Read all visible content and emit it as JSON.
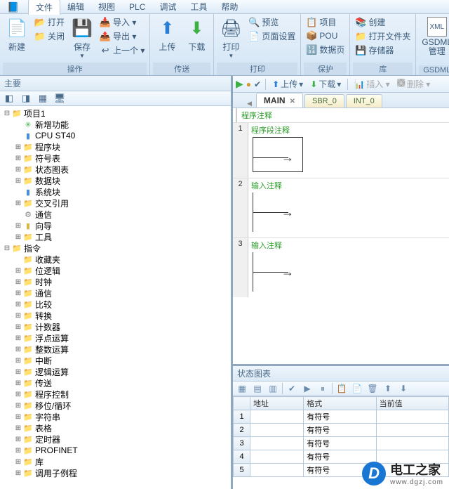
{
  "menu": {
    "items": [
      "文件",
      "编辑",
      "视图",
      "PLC",
      "调试",
      "工具",
      "帮助"
    ],
    "active": 0
  },
  "ribbon": {
    "groups": [
      {
        "title": "操作",
        "big": [
          {
            "icon": "📄",
            "label": "新建"
          }
        ],
        "small": [
          {
            "icon": "📂",
            "label": "打开"
          },
          {
            "icon": "✖",
            "label": "关闭"
          }
        ],
        "big2": [
          {
            "icon": "💾",
            "label": "保存",
            "drop": true
          }
        ],
        "small2": [
          {
            "icon": "📥",
            "label": "导入 ▾"
          },
          {
            "icon": "📤",
            "label": "导出 ▾"
          },
          {
            "icon": "↩",
            "label": "上一个 ▾"
          }
        ]
      },
      {
        "title": "传送",
        "big": [
          {
            "icon": "⬆",
            "label": "上传",
            "cls": "arrow-up"
          },
          {
            "icon": "⬇",
            "label": "下载",
            "cls": "arrow-down"
          }
        ]
      },
      {
        "title": "打印",
        "big": [
          {
            "icon": "🖨",
            "label": "打印",
            "drop": true
          }
        ],
        "small": [
          {
            "icon": "🔍",
            "label": "预览"
          },
          {
            "icon": "📄",
            "label": "页面设置"
          }
        ]
      },
      {
        "title": "保护",
        "small": [
          {
            "icon": "📋",
            "label": "项目"
          },
          {
            "icon": "📦",
            "label": "POU"
          },
          {
            "icon": "🔢",
            "label": "数据页"
          }
        ]
      },
      {
        "title": "库",
        "small": [
          {
            "icon": "📚",
            "label": "创建"
          },
          {
            "icon": "📁",
            "label": "打开文件夹"
          },
          {
            "icon": "💾",
            "label": "存储器"
          }
        ]
      },
      {
        "title": "GSDML",
        "big": [
          {
            "icon": "XML",
            "label": "GSDML\n管理",
            "cls": "xml"
          }
        ]
      }
    ]
  },
  "leftPanel": {
    "title": "主要"
  },
  "tree": [
    {
      "d": 0,
      "e": "-",
      "i": "folder",
      "t": "项目1"
    },
    {
      "d": 1,
      "e": "",
      "i": "block-green",
      "t": "新增功能"
    },
    {
      "d": 1,
      "e": "",
      "i": "block-blue",
      "t": "CPU ST40"
    },
    {
      "d": 1,
      "e": "+",
      "i": "folder",
      "t": "程序块"
    },
    {
      "d": 1,
      "e": "+",
      "i": "folder",
      "t": "符号表"
    },
    {
      "d": 1,
      "e": "+",
      "i": "folder",
      "t": "状态图表"
    },
    {
      "d": 1,
      "e": "+",
      "i": "folder",
      "t": "数据块"
    },
    {
      "d": 1,
      "e": "",
      "i": "block-blue",
      "t": "系统块"
    },
    {
      "d": 1,
      "e": "+",
      "i": "folder",
      "t": "交叉引用"
    },
    {
      "d": 1,
      "e": "",
      "i": "block-gear",
      "t": "通信"
    },
    {
      "d": 1,
      "e": "+",
      "i": "block-yellow",
      "t": "向导"
    },
    {
      "d": 1,
      "e": "+",
      "i": "folder",
      "t": "工具"
    },
    {
      "d": 0,
      "e": "-",
      "i": "folder",
      "t": "指令"
    },
    {
      "d": 1,
      "e": "",
      "i": "folder",
      "t": "收藏夹"
    },
    {
      "d": 1,
      "e": "+",
      "i": "folder",
      "t": "位逻辑"
    },
    {
      "d": 1,
      "e": "+",
      "i": "folder",
      "t": "时钟"
    },
    {
      "d": 1,
      "e": "+",
      "i": "folder",
      "t": "通信"
    },
    {
      "d": 1,
      "e": "+",
      "i": "folder",
      "t": "比较"
    },
    {
      "d": 1,
      "e": "+",
      "i": "folder",
      "t": "转换"
    },
    {
      "d": 1,
      "e": "+",
      "i": "folder",
      "t": "计数器"
    },
    {
      "d": 1,
      "e": "+",
      "i": "folder",
      "t": "浮点运算"
    },
    {
      "d": 1,
      "e": "+",
      "i": "folder",
      "t": "整数运算"
    },
    {
      "d": 1,
      "e": "+",
      "i": "folder",
      "t": "中断"
    },
    {
      "d": 1,
      "e": "+",
      "i": "folder",
      "t": "逻辑运算"
    },
    {
      "d": 1,
      "e": "+",
      "i": "folder",
      "t": "传送"
    },
    {
      "d": 1,
      "e": "+",
      "i": "folder",
      "t": "程序控制"
    },
    {
      "d": 1,
      "e": "+",
      "i": "folder",
      "t": "移位/循环"
    },
    {
      "d": 1,
      "e": "+",
      "i": "folder",
      "t": "字符串"
    },
    {
      "d": 1,
      "e": "+",
      "i": "folder",
      "t": "表格"
    },
    {
      "d": 1,
      "e": "+",
      "i": "folder",
      "t": "定时器"
    },
    {
      "d": 1,
      "e": "+",
      "i": "folder",
      "t": "PROFINET"
    },
    {
      "d": 1,
      "e": "+",
      "i": "folder",
      "t": "库"
    },
    {
      "d": 1,
      "e": "+",
      "i": "folder",
      "t": "调用子例程"
    }
  ],
  "rightToolbar": {
    "upload": "上传",
    "download": "下载",
    "insert": "插入 ▾",
    "delete": "删除 ▾"
  },
  "tabs": [
    {
      "label": "MAIN",
      "active": true,
      "close": true
    },
    {
      "label": "SBR_0"
    },
    {
      "label": "INT_0"
    }
  ],
  "editor": {
    "topComment": "程序注释",
    "networks": [
      {
        "n": "1",
        "c": "程序段注释",
        "box": true
      },
      {
        "n": "2",
        "c": "输入注释"
      },
      {
        "n": "3",
        "c": "输入注释"
      }
    ]
  },
  "status": {
    "title": "状态图表",
    "cols": [
      "",
      "地址",
      "格式",
      "当前值"
    ],
    "rows": [
      {
        "n": "1",
        "addr": "",
        "fmt": "有符号",
        "val": ""
      },
      {
        "n": "2",
        "addr": "",
        "fmt": "有符号",
        "val": ""
      },
      {
        "n": "3",
        "addr": "",
        "fmt": "有符号",
        "val": ""
      },
      {
        "n": "4",
        "addr": "",
        "fmt": "有符号",
        "val": ""
      },
      {
        "n": "5",
        "addr": "",
        "fmt": "有符号",
        "val": ""
      }
    ]
  },
  "watermark": {
    "brand": "电工之家",
    "url": "www.dgzj.com"
  }
}
